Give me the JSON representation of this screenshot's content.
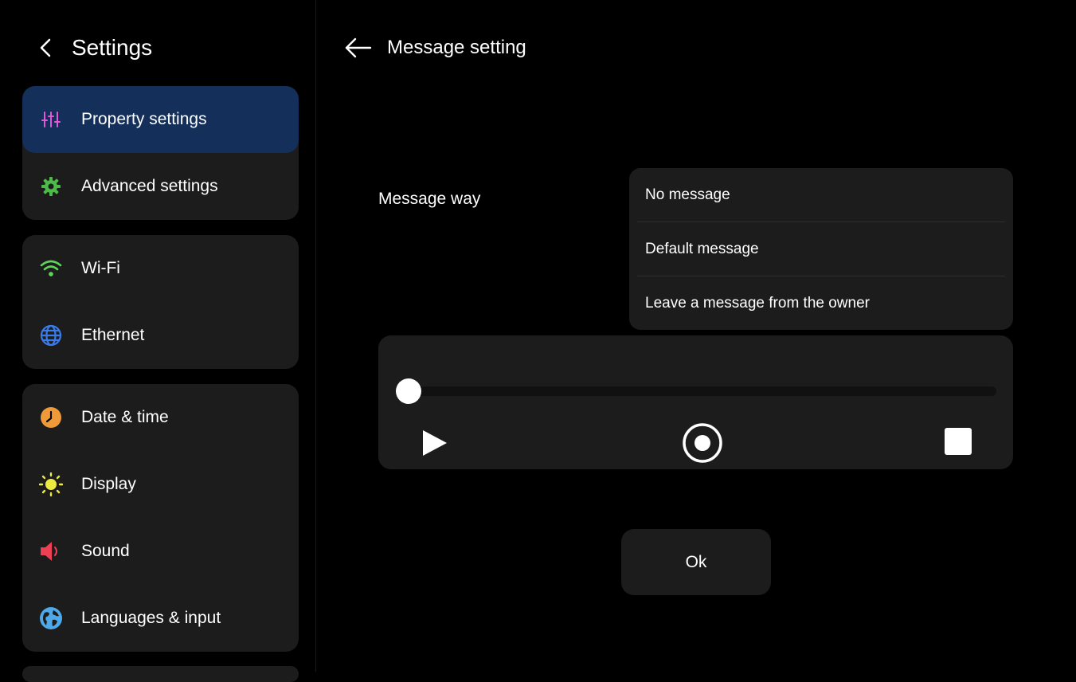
{
  "sidebar": {
    "title": "Settings",
    "groups": [
      {
        "items": [
          {
            "label": "Property settings",
            "icon": "sliders-icon",
            "active": true
          },
          {
            "label": "Advanced settings",
            "icon": "gear-icon"
          }
        ]
      },
      {
        "items": [
          {
            "label": "Wi-Fi",
            "icon": "wifi-icon"
          },
          {
            "label": "Ethernet",
            "icon": "globe-icon"
          }
        ]
      },
      {
        "items": [
          {
            "label": "Date & time",
            "icon": "clock-icon"
          },
          {
            "label": "Display",
            "icon": "sun-icon"
          },
          {
            "label": "Sound",
            "icon": "speaker-icon"
          },
          {
            "label": "Languages & input",
            "icon": "earth-icon"
          }
        ]
      }
    ]
  },
  "main": {
    "title": "Message setting",
    "message_way_label": "Message way",
    "options": [
      "No message",
      "Default message",
      "Leave a message from the owner"
    ],
    "player": {
      "progress": 0
    },
    "ok_label": "Ok"
  },
  "colors": {
    "active_bg": "#14305a",
    "panel_bg": "#1c1c1c",
    "sliders": "#e05ad8",
    "gear": "#4cbb47",
    "wifi": "#5fd45a",
    "globe": "#3a7bea",
    "clock": "#ef9a38",
    "sun": "#ecea3e",
    "speaker": "#ee3f55",
    "earth": "#4fa8e8"
  }
}
